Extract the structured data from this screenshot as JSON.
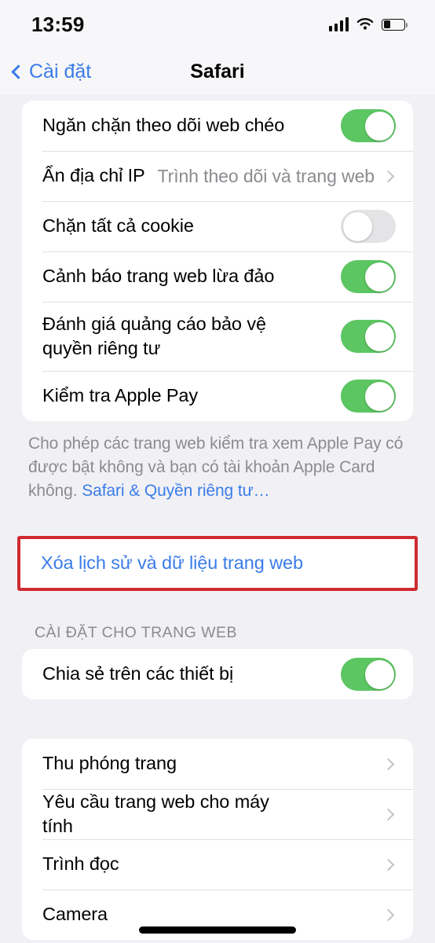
{
  "status_bar": {
    "time": "13:59",
    "signal_icon": "cellular-bars-icon",
    "wifi_icon": "wifi-icon",
    "battery_icon": "battery-icon",
    "battery_level_percent": 35
  },
  "nav": {
    "back_label": "Cài đặt",
    "back_icon": "chevron-left-icon",
    "title": "Safari"
  },
  "colors": {
    "accent_blue": "#3b7ce8",
    "toggle_on_green": "#5cc662",
    "toggle_off_gray": "#e4e4e6",
    "highlight_red": "#d02a31",
    "background": "#f1f1f5",
    "card": "#ffffff",
    "secondary_text": "#8b8b90"
  },
  "privacy_group": {
    "rows": [
      {
        "label": "Ngăn chặn theo dõi web chéo",
        "control": "toggle",
        "value": "on"
      },
      {
        "label": "Ẩn địa chỉ IP",
        "control": "disclosure",
        "value": "Trình theo dõi và trang web"
      },
      {
        "label": "Chặn tất cả cookie",
        "control": "toggle",
        "value": "off"
      },
      {
        "label": "Cảnh báo trang web lừa đảo",
        "control": "toggle",
        "value": "on"
      },
      {
        "label": "Đánh giá quảng cáo bảo vệ quyền riêng tư",
        "control": "toggle",
        "value": "on"
      },
      {
        "label": "Kiểm tra Apple Pay",
        "control": "toggle",
        "value": "on"
      }
    ],
    "footer_text": "Cho phép các trang web kiểm tra xem Apple Pay có được bật không và bạn có tài khoản Apple Card không.",
    "footer_link": "Safari & Quyền riêng tư…"
  },
  "clear_group": {
    "label": "Xóa lịch sử và dữ liệu trang web",
    "highlighted": true
  },
  "website_settings": {
    "header": "CÀI ĐẶT CHO TRANG WEB",
    "rows": [
      {
        "label": "Chia sẻ trên các thiết bị",
        "control": "toggle",
        "value": "on"
      }
    ]
  },
  "page_options_group": {
    "rows": [
      {
        "label": "Thu phóng trang",
        "control": "disclosure"
      },
      {
        "label": "Yêu cầu trang web cho máy tính",
        "control": "disclosure"
      },
      {
        "label": "Trình đọc",
        "control": "disclosure"
      },
      {
        "label": "Camera",
        "control": "disclosure"
      }
    ]
  }
}
